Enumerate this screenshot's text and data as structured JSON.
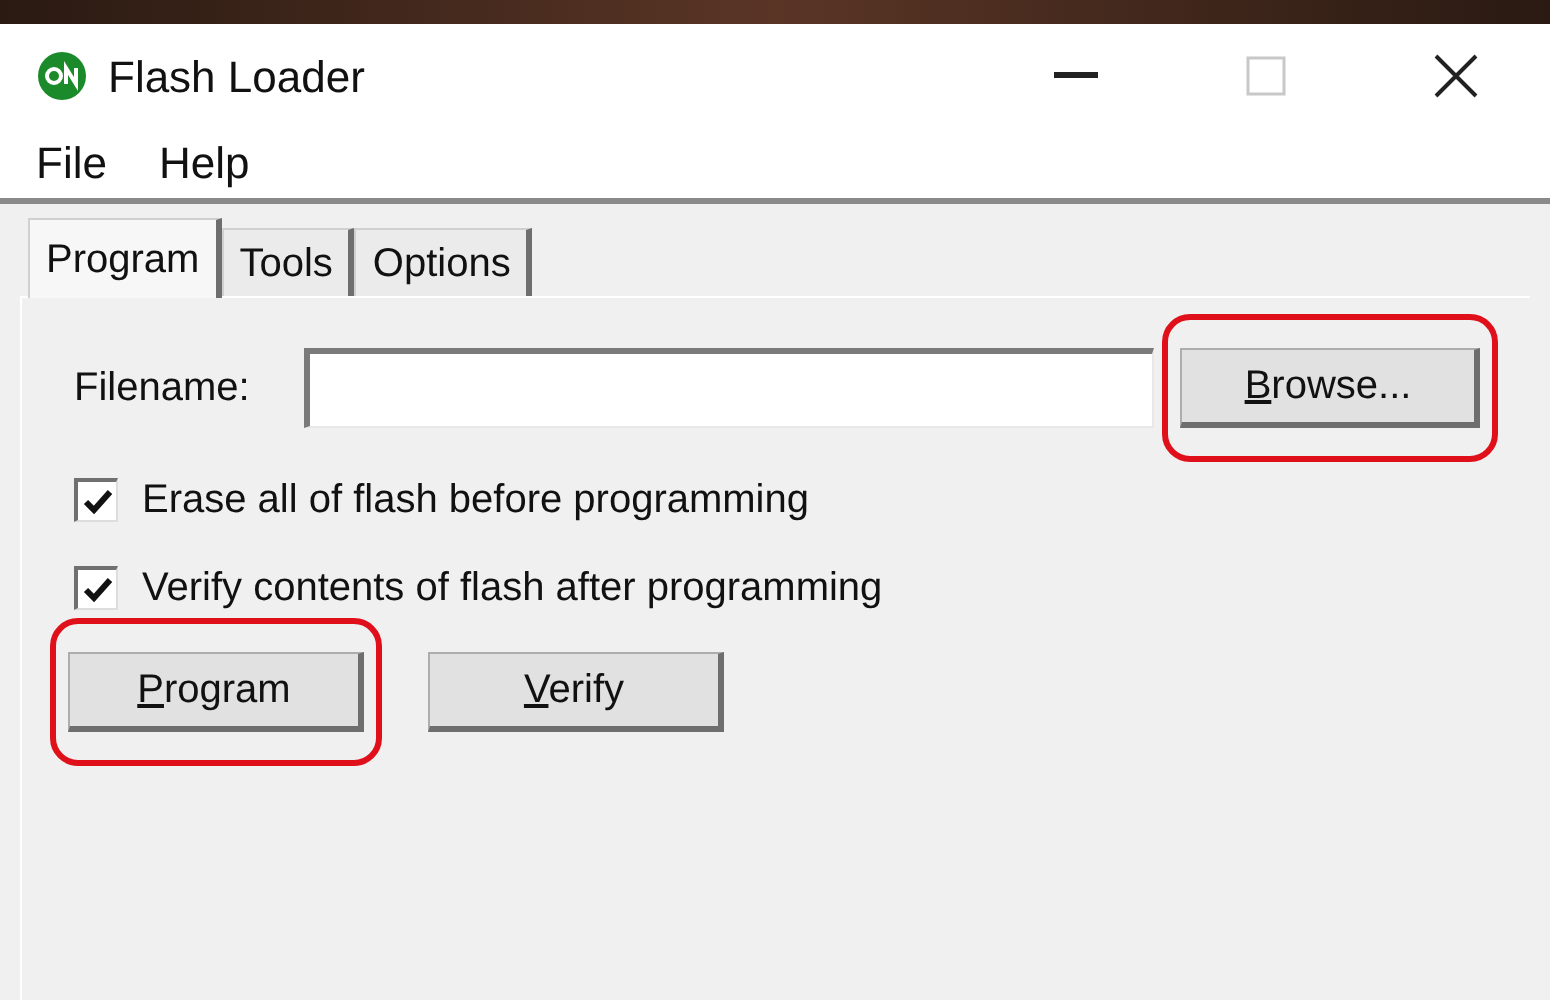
{
  "window": {
    "title": "Flash Loader",
    "controls": [
      {
        "kind": "minimize"
      },
      {
        "kind": "maximize"
      },
      {
        "kind": "close"
      }
    ]
  },
  "menu": [
    "File",
    "Help"
  ],
  "tabs": [
    {
      "label": "Program",
      "selected": true
    },
    {
      "label": "Tools",
      "selected": false
    },
    {
      "label": "Options",
      "selected": false
    }
  ],
  "filename": {
    "label": "Filename:"
  },
  "browse_button": {
    "label": "Browse...",
    "mnemonic": true,
    "highlighted": true
  },
  "checkboxes": [
    {
      "label": "Erase all of flash before programming",
      "checked": true
    },
    {
      "label": "Verify contents of flash after programming",
      "checked": true
    }
  ],
  "buttons": [
    {
      "label": "Program",
      "mnemonic": true,
      "highlighted": true
    },
    {
      "label": "Verify",
      "mnemonic": true,
      "highlighted": false
    }
  ]
}
